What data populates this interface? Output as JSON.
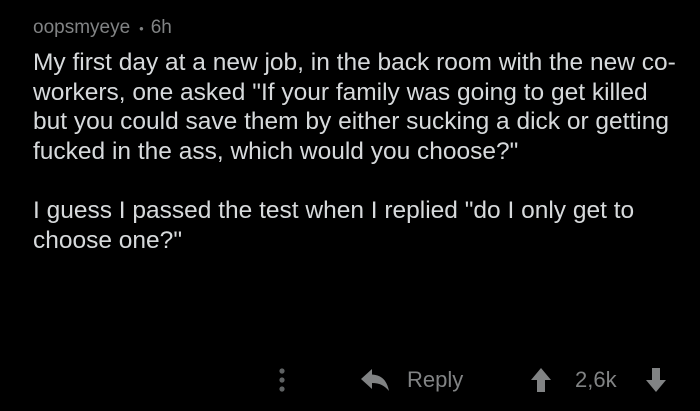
{
  "comment": {
    "author": "oopsmyeye",
    "separator": "•",
    "age": "6h",
    "paragraphs": [
      "My first day at a new job, in the back room with the new co-workers, one asked \"If your family was going to get killed but you could save them by either sucking a dick or getting fucked in the ass, which would you choose?\"",
      "I guess I passed the test when I replied \"do I only get to choose one?\""
    ]
  },
  "actions": {
    "more_icon": "more-vertical-icon",
    "reply_icon": "reply-arrow-icon",
    "reply_label": "Reply",
    "upvote_icon": "upvote-arrow-icon",
    "score": "2,6k",
    "downvote_icon": "downvote-arrow-icon"
  },
  "colors": {
    "background": "#000000",
    "body_text": "#d7dadc",
    "muted_text": "#818384"
  }
}
